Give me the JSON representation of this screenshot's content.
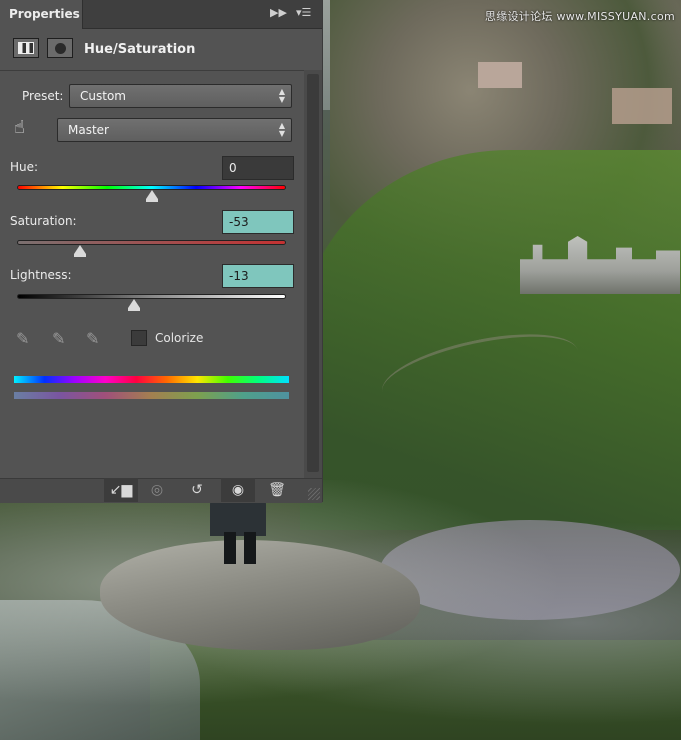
{
  "watermark": "思缘设计论坛 www.MISSYUAN.com",
  "panel": {
    "tab_label": "Properties",
    "title": "Hue/Saturation",
    "preset_label": "Preset:",
    "preset_value": "Custom",
    "channel_value": "Master",
    "hue": {
      "label": "Hue:",
      "value": "0",
      "position": 0.5
    },
    "saturation": {
      "label": "Saturation:",
      "value": "-53",
      "position": 0.235
    },
    "lightness": {
      "label": "Lightness:",
      "value": "-13",
      "position": 0.435
    },
    "colorize_label": "Colorize",
    "colorize_checked": false,
    "highlight_color": "#7fc6bd",
    "icons": {
      "tab_expand": "double-chevron-right-icon",
      "panel_menu": "panel-menu-icon",
      "adjustment": "hue-saturation-adjustment-icon",
      "mask": "layer-mask-icon",
      "hand": "targeted-adjustment-hand-icon",
      "eyedropper": "eyedropper-icon",
      "eyedropper_add": "eyedropper-add-icon",
      "eyedropper_subtract": "eyedropper-subtract-icon",
      "clip": "clip-to-layer-icon",
      "previous_state": "view-previous-state-icon",
      "reset": "reset-icon",
      "visibility": "eye-icon",
      "delete": "trash-icon"
    }
  }
}
